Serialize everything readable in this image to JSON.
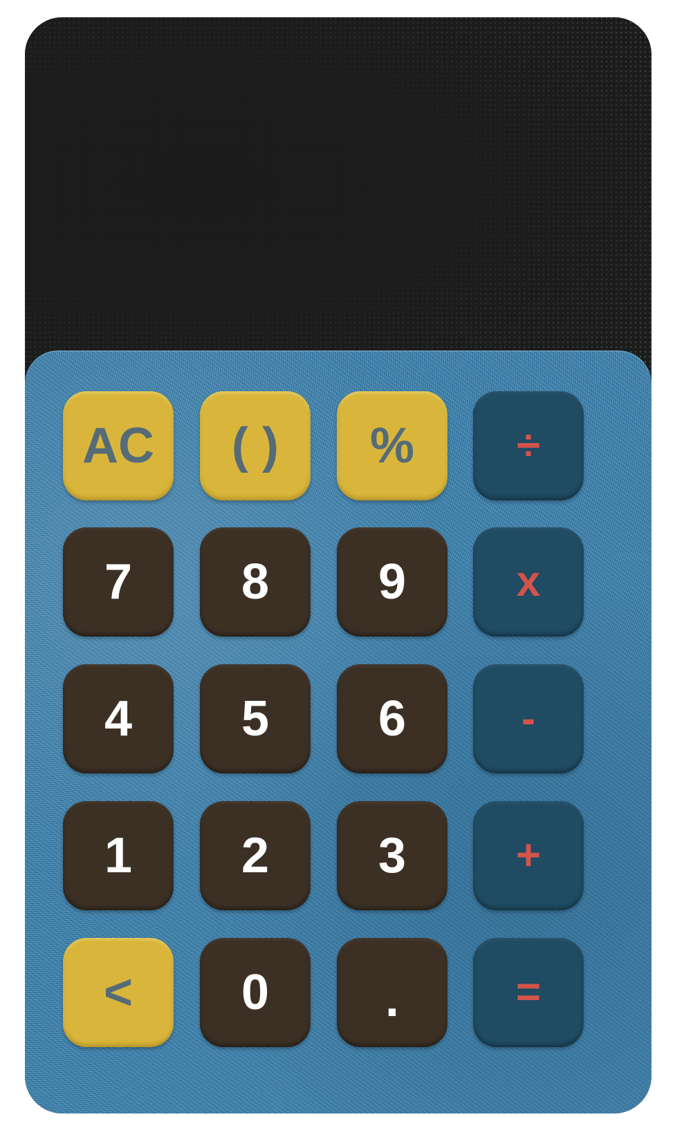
{
  "display": {
    "value": ""
  },
  "keys": {
    "ac": "AC",
    "parens": "( )",
    "percent": "%",
    "divide": "÷",
    "seven": "7",
    "eight": "8",
    "nine": "9",
    "multiply": "x",
    "four": "4",
    "five": "5",
    "six": "6",
    "subtract": "-",
    "one": "1",
    "two": "2",
    "three": "3",
    "add": "+",
    "backspace": "<",
    "zero": "0",
    "decimal": ".",
    "equals": "="
  },
  "colors": {
    "display_bg": "#1c1c1c",
    "keypad_bg": "#3f86b2",
    "function_key": "#d9b63b",
    "function_text": "#556b78",
    "number_key": "#3c3025",
    "number_text": "#ffffff",
    "operator_key": "#1f4b63",
    "operator_text": "#d2544b"
  }
}
